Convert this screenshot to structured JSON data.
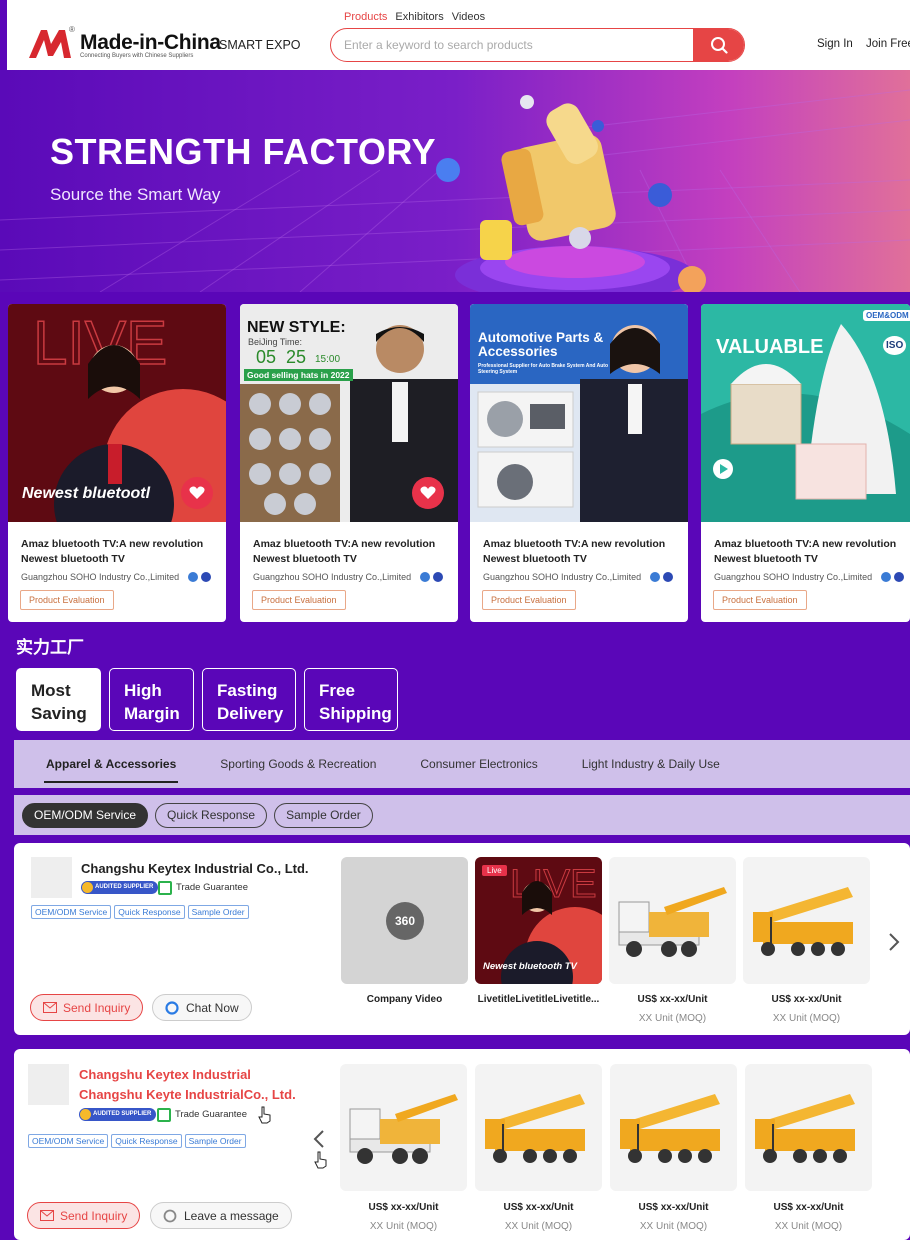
{
  "header": {
    "brand": "Made-in-China",
    "brand_tagline": "Connecting Buyers with Chinese Suppliers",
    "smart_expo": "SMART EXPO",
    "search_tabs": [
      "Products",
      "Exhibitors",
      "Videos"
    ],
    "search_placeholder": "Enter a keyword to search products",
    "sign_in": "Sign In",
    "join_free": "Join Free",
    "accent_color": "#e64545"
  },
  "banner": {
    "title": "STRENGTH FACTORY",
    "subtitle": "Source the Smart Way"
  },
  "live_cards": [
    {
      "overlay": "Newest bluetootl",
      "title": "Amaz bluetooth TV:A new revolution Newest bluetooth TV",
      "company": "Guangzhou SOHO Industry Co.,Limited",
      "eval": "Product Evaluation"
    },
    {
      "overlay_title": "NEW STYLE:",
      "overlay_time_label": "BeiJing Time:",
      "overlay_date": "05",
      "overlay_date2": "25",
      "overlay_clock": "15:00",
      "overlay_sub": "Good selling hats in 2022",
      "title": "Amaz bluetooth TV:A new revolution Newest bluetooth TV",
      "company": "Guangzhou SOHO Industry Co.,Limited",
      "eval": "Product Evaluation"
    },
    {
      "overlay_title": "Automotive Parts & Accessories",
      "overlay_sub": "Professional Supplier for Auto Brake System And Auto Steering System",
      "title": "Amaz bluetooth TV:A new revolution Newest bluetooth TV",
      "company": "Guangzhou SOHO Industry Co.,Limited",
      "eval": "Product Evaluation"
    },
    {
      "overlay_title": "VALUABLE",
      "overlay_badge": "OEM&ODM",
      "overlay_iso": "ISO",
      "title": "Amaz bluetooth TV:A new revolution Newest bluetooth TV",
      "company": "Guangzhou SOHO Industry Co.,Limited",
      "eval": "Product Evaluation"
    }
  ],
  "section": {
    "title": "实力工厂",
    "filter_tabs": [
      {
        "line1": "Most",
        "line2": "Saving"
      },
      {
        "line1": "High",
        "line2": "Margin"
      },
      {
        "line1": "Fasting",
        "line2": "Delivery"
      },
      {
        "line1": "Free",
        "line2": "Shipping"
      }
    ],
    "categories": [
      "Apparel & Accessories",
      "Sporting Goods & Recreation",
      "Consumer Electronics",
      "Light Industry & Daily Use"
    ],
    "services": [
      "OEM/ODM Service",
      "Quick Response",
      "Sample Order"
    ]
  },
  "suppliers": [
    {
      "name": "Changshu Keytex Industrial Co., Ltd.",
      "audit": "AUDITED SUPPLIER",
      "trade": "Trade Guarantee",
      "tags": [
        "OEM/ODM Service",
        "Quick Response",
        "Sample Order"
      ],
      "inquiry": "Send Inquiry",
      "chat": "Chat Now",
      "products": [
        {
          "label": "Company Video",
          "badge": "360"
        },
        {
          "label": "LivetitleLivetitleLivetitle...",
          "live": "Live",
          "overlay": "Newest bluetooth TV"
        },
        {
          "label": "US$ xx-xx/Unit",
          "moq": "XX Unit (MOQ)"
        },
        {
          "label": "US$ xx-xx/Unit",
          "moq": "XX Unit (MOQ)"
        }
      ]
    },
    {
      "name_line1": "Changshu Keytex Industrial",
      "name_line2": "Changshu Keyte IndustrialCo., Ltd.",
      "audit": "AUDITED SUPPLIER",
      "trade": "Trade Guarantee",
      "tags": [
        "OEM/ODM Service",
        "Quick Response",
        "Sample Order"
      ],
      "inquiry": "Send Inquiry",
      "message": "Leave a message",
      "products": [
        {
          "label": "US$ xx-xx/Unit",
          "moq": "XX Unit (MOQ)"
        },
        {
          "label": "US$ xx-xx/Unit",
          "moq": "XX Unit (MOQ)"
        },
        {
          "label": "US$ xx-xx/Unit",
          "moq": "XX Unit (MOQ)"
        },
        {
          "label": "US$ xx-xx/Unit",
          "moq": "XX Unit (MOQ)"
        }
      ]
    }
  ]
}
